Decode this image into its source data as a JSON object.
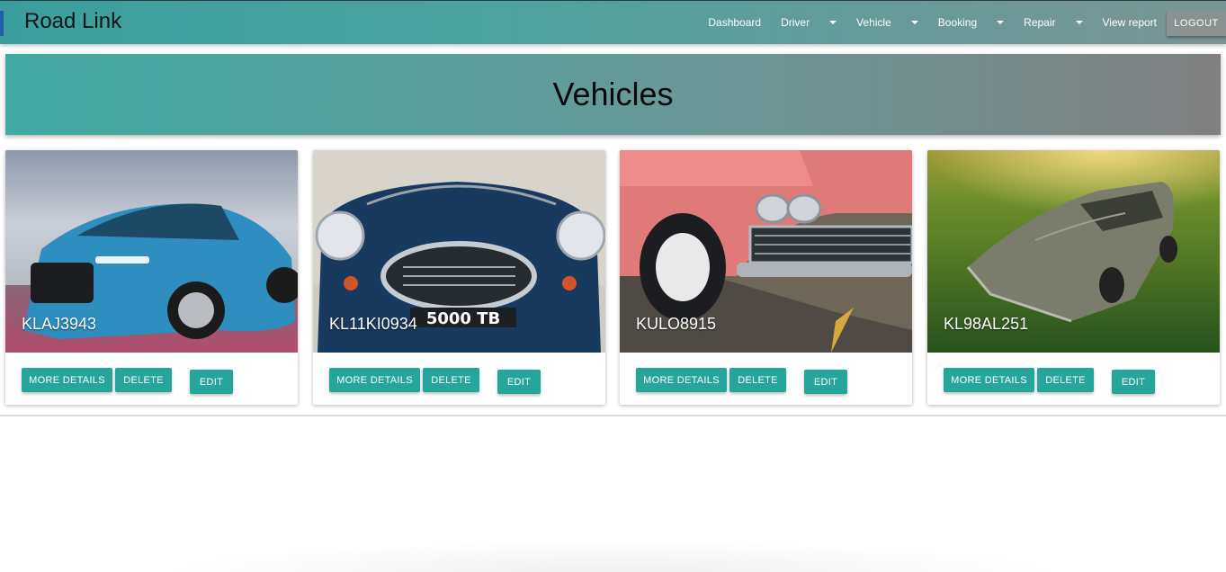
{
  "navbar": {
    "brand": "Road Link",
    "items": [
      {
        "label": "Dashboard",
        "dropdown": false
      },
      {
        "label": "Driver",
        "dropdown": true
      },
      {
        "label": "Vehicle",
        "dropdown": true
      },
      {
        "label": "Booking",
        "dropdown": true
      },
      {
        "label": "Repair",
        "dropdown": true
      },
      {
        "label": "View report",
        "dropdown": false
      }
    ],
    "logout_label": "LOGOUT"
  },
  "page": {
    "title": "Vehicles"
  },
  "vehicles": [
    {
      "reg": "KLAJ3943",
      "image": "blue-sedan-image",
      "more": "MORE DETAILS",
      "delete": "DELETE",
      "edit": "EDIT"
    },
    {
      "reg": "KL11KI0934",
      "image": "vintage-roadster-image",
      "plate": "5000 TB",
      "more": "MORE DETAILS",
      "delete": "DELETE",
      "edit": "EDIT"
    },
    {
      "reg": "KULO8915",
      "image": "pink-classic-car-image",
      "more": "MORE DETAILS",
      "delete": "DELETE",
      "edit": "EDIT"
    },
    {
      "reg": "KL98AL251",
      "image": "grey-coupe-image",
      "more": "MORE DETAILS",
      "delete": "DELETE",
      "edit": "EDIT"
    }
  ],
  "colors": {
    "accent": "#26a69a",
    "nav_start": "#3a9f9c",
    "nav_end": "#7a9595",
    "logout": "#8a9291"
  }
}
